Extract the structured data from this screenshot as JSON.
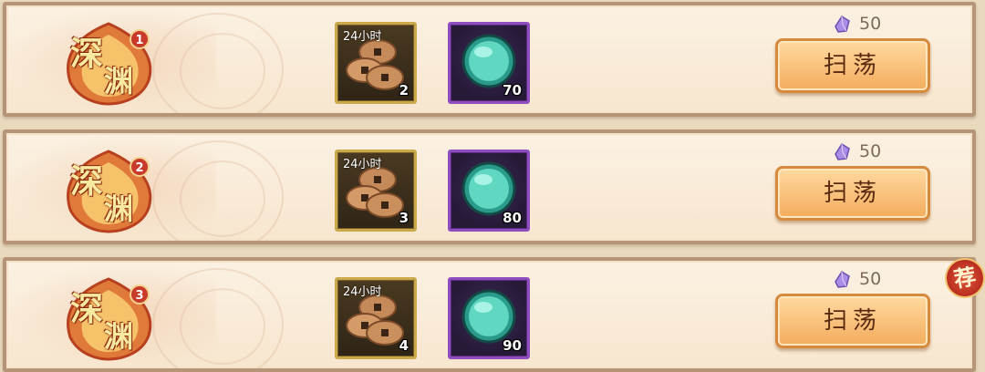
{
  "colors": {
    "panel": "#fbf1e2",
    "frame": "#b59478",
    "button": "#f3ac5c",
    "coin_frame": "#c9a94a",
    "gem_frame": "#8e4dbf"
  },
  "rows": [
    {
      "emblem_top": "深",
      "emblem_bottom": "渊",
      "level": "1",
      "coin_tag": "24小时",
      "coin_count": "2",
      "gem_count": "70",
      "cost": "50",
      "button": "扫荡"
    },
    {
      "emblem_top": "深",
      "emblem_bottom": "渊",
      "level": "2",
      "coin_tag": "24小时",
      "coin_count": "3",
      "gem_count": "80",
      "cost": "50",
      "button": "扫荡"
    },
    {
      "emblem_top": "深",
      "emblem_bottom": "渊",
      "level": "3",
      "coin_tag": "24小时",
      "coin_count": "4",
      "gem_count": "90",
      "cost": "50",
      "button": "扫荡"
    }
  ],
  "recommend_badge": "荐",
  "icons": {
    "coin": "copper-coins-icon",
    "gem": "jade-orb-icon",
    "cost": "purple-crystal-icon"
  }
}
